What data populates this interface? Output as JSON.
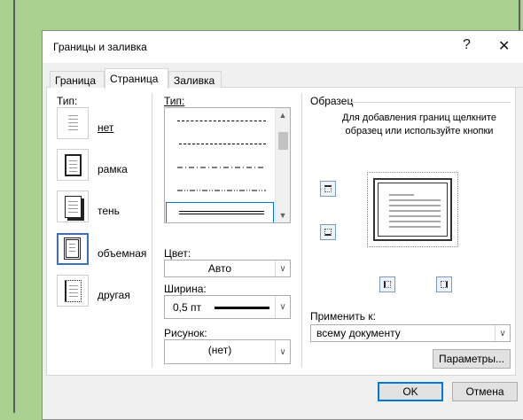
{
  "dialog": {
    "title": "Границы и заливка",
    "help_glyph": "?",
    "close_glyph": "✕"
  },
  "tabs": [
    {
      "label": "Граница",
      "active": false
    },
    {
      "label": "Страница",
      "active": true
    },
    {
      "label": "Заливка",
      "active": false
    }
  ],
  "setting": {
    "label": "Тип:",
    "options": [
      {
        "label": "нет",
        "icon": "none-border-icon",
        "selected": false
      },
      {
        "label": "рамка",
        "icon": "box-border-icon",
        "selected": false
      },
      {
        "label": "тень",
        "icon": "shadow-border-icon",
        "selected": false
      },
      {
        "label": "объемная",
        "icon": "3d-border-icon",
        "selected": true
      },
      {
        "label": "другая",
        "icon": "custom-border-icon",
        "selected": false
      }
    ]
  },
  "style": {
    "label": "Тип:",
    "items": [
      "dashed-fine",
      "dashed",
      "dash-dot",
      "dash-dot-dot",
      "double"
    ],
    "selected_index": 4
  },
  "color": {
    "label": "Цвет:",
    "value": "Авто"
  },
  "width": {
    "label": "Ширина:",
    "value": "0,5 пт"
  },
  "art": {
    "label": "Рисунок:",
    "value": "(нет)"
  },
  "preview": {
    "group_label": "Образец",
    "hint": "Для добавления границ щелкните образец или используйте кнопки"
  },
  "apply_to": {
    "label": "Применить к:",
    "value": "всему документу"
  },
  "buttons": {
    "options": "Параметры...",
    "ok": "OK",
    "cancel": "Отмена"
  },
  "colors": {
    "background": "#a9d08e",
    "accent": "#0078d7"
  }
}
